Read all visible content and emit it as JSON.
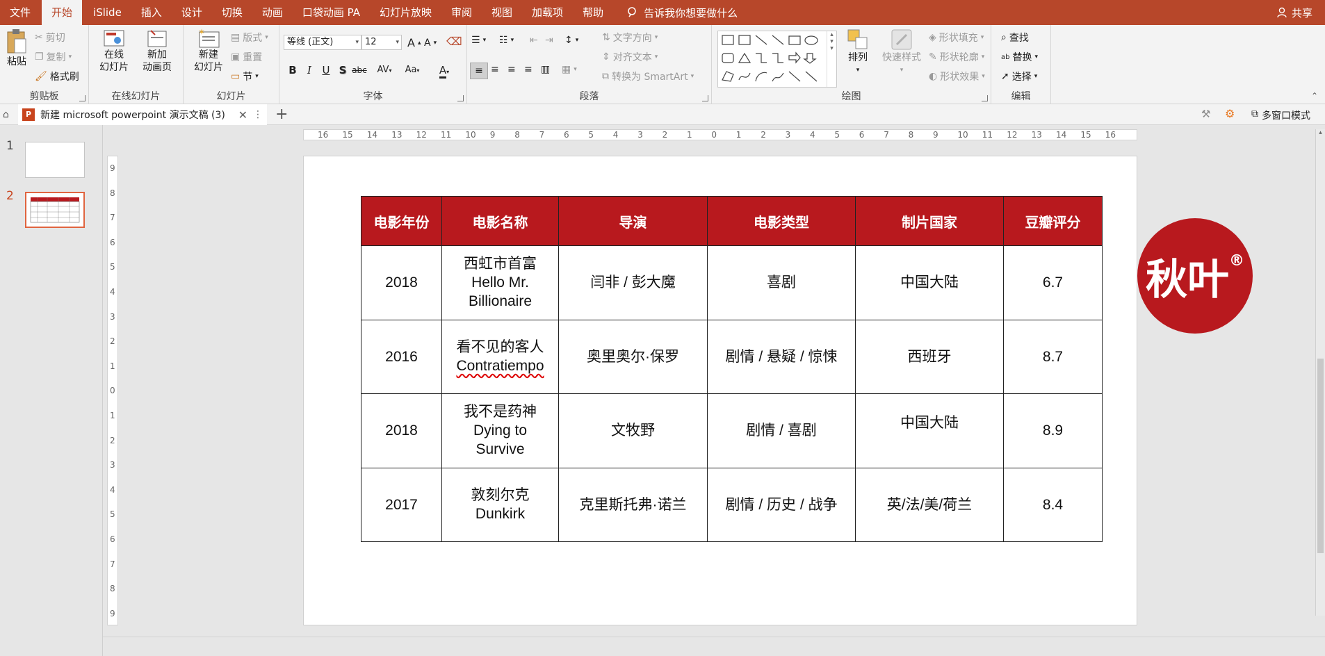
{
  "menu": {
    "tabs": [
      "文件",
      "开始",
      "iSlide",
      "插入",
      "设计",
      "切换",
      "动画",
      "口袋动画 PA",
      "幻灯片放映",
      "审阅",
      "视图",
      "加载项",
      "帮助"
    ],
    "active_tab": "开始",
    "tell_me": "告诉我你想要做什么",
    "share": "共享"
  },
  "ribbon": {
    "clipboard": {
      "label": "剪贴板",
      "paste": "粘贴",
      "cut": "剪切",
      "copy": "复制",
      "format_painter": "格式刷"
    },
    "online": {
      "label": "在线幻灯片",
      "online_slides": [
        "在线",
        "幻灯片"
      ],
      "new_anim": [
        "新加",
        "动画页"
      ]
    },
    "slides": {
      "label": "幻灯片",
      "new_slide": [
        "新建",
        "幻灯片"
      ],
      "layout": "版式",
      "reset": "重置",
      "section": "节"
    },
    "font": {
      "label": "字体",
      "font_name": "等线 (正文)",
      "font_size": "12",
      "grow": "A",
      "shrink": "A",
      "bold": "B",
      "italic": "I",
      "underline": "U",
      "shadow": "S",
      "strike": "abc",
      "spacing": "AV",
      "case": "Aa",
      "color": "A"
    },
    "paragraph": {
      "label": "段落",
      "text_direction": "文字方向",
      "align_text": "对齐文本",
      "smartart": "转换为 SmartArt"
    },
    "drawing": {
      "label": "绘图",
      "arrange": "排列",
      "quick_styles": "快速样式",
      "fill": "形状填充",
      "outline": "形状轮廓",
      "effects": "形状效果"
    },
    "editing": {
      "label": "编辑",
      "find": "查找",
      "replace": "替换",
      "select": "选择"
    }
  },
  "tabbar": {
    "doc_title": "新建 microsoft powerpoint 演示文稿 (3)",
    "multiwindow": "多窗口模式"
  },
  "thumbnails": [
    {
      "num": "1"
    },
    {
      "num": "2"
    }
  ],
  "ruler": {
    "h": [
      "16",
      "15",
      "14",
      "13",
      "12",
      "11",
      "10",
      "9",
      "8",
      "7",
      "6",
      "5",
      "4",
      "3",
      "2",
      "1",
      "0",
      "1",
      "2",
      "3",
      "4",
      "5",
      "6",
      "7",
      "8",
      "9",
      "10",
      "11",
      "12",
      "13",
      "14",
      "15",
      "16"
    ],
    "v": [
      "9",
      "8",
      "7",
      "6",
      "5",
      "4",
      "3",
      "2",
      "1",
      "0",
      "1",
      "2",
      "3",
      "4",
      "5",
      "6",
      "7",
      "8",
      "9"
    ]
  },
  "table": {
    "headers": [
      "电影年份",
      "电影名称",
      "导演",
      "电影类型",
      "制片国家",
      "豆瓣评分"
    ],
    "rows": [
      {
        "year": "2018",
        "title": [
          "西虹市首富",
          "Hello Mr.",
          "Billionaire"
        ],
        "director": "闫非 / 彭大魔",
        "genre": "喜剧",
        "country": "中国大陆",
        "rating": "6.7"
      },
      {
        "year": "2016",
        "title": [
          "看不见的客人",
          "Contratiempo"
        ],
        "director": "奥里奥尔·保罗",
        "genre": "剧情 / 悬疑 / 惊悚",
        "country": "西班牙",
        "rating": "8.7"
      },
      {
        "year": "2018",
        "title": [
          "我不是药神",
          "Dying to",
          "Survive"
        ],
        "director": "文牧野",
        "genre": "剧情 / 喜剧",
        "country": "中国大陆",
        "rating": "8.9"
      },
      {
        "year": "2017",
        "title": [
          "敦刻尔克",
          "Dunkirk"
        ],
        "director": "克里斯托弗·诺兰",
        "genre": "剧情 / 历史 / 战争",
        "country": "英/法/美/荷兰",
        "rating": "8.4"
      }
    ]
  },
  "logo": {
    "text": "秋叶",
    "mark": "®"
  },
  "colors": {
    "accent": "#b7472a",
    "table_header": "#b8191e",
    "logo": "#b8191e"
  }
}
